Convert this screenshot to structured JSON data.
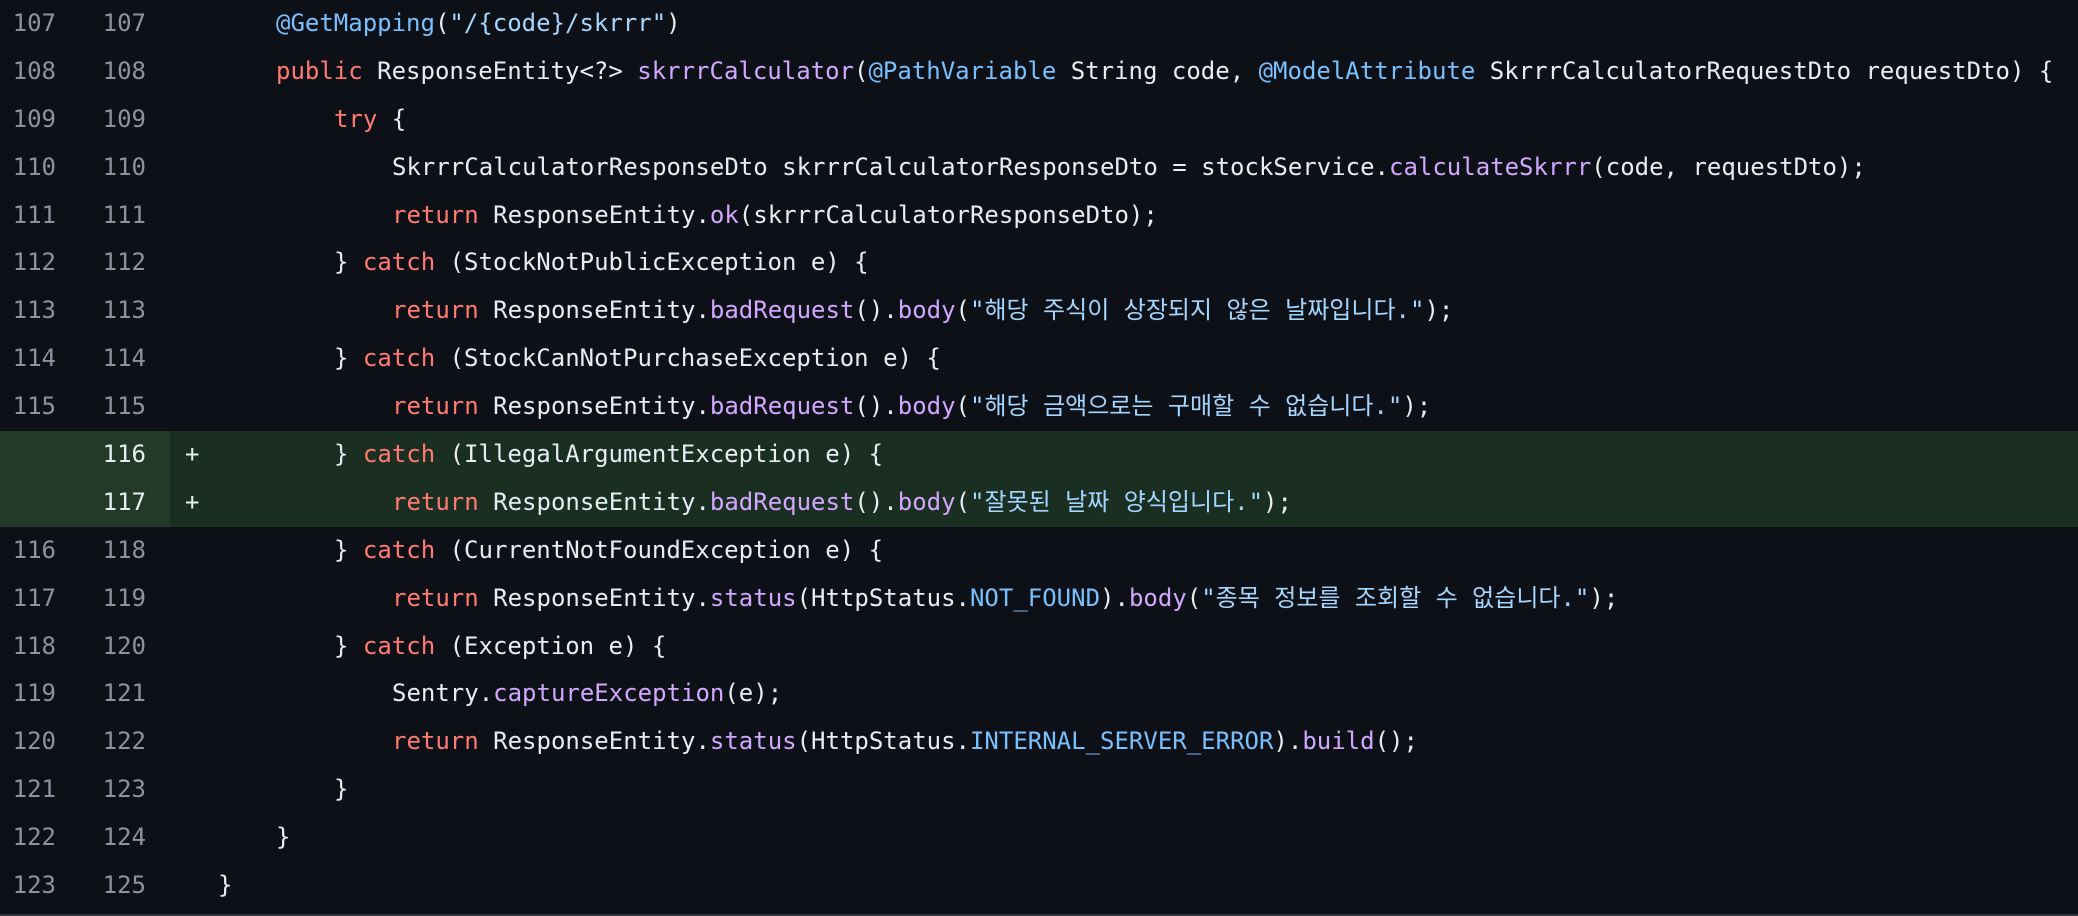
{
  "colors": {
    "background": "#0d1117",
    "added_background": "#1b2e22",
    "added_gutter": "#223a27",
    "line_number": "#8b949e",
    "keyword": "#ff7b72",
    "function": "#d2a8ff",
    "annotation": "#79c0ff",
    "string": "#a5d6ff",
    "text": "#e6edf3"
  },
  "lines": [
    {
      "old": "107",
      "new": "107",
      "marker": "",
      "type": "context",
      "indent": 1,
      "tokens": [
        {
          "t": "an",
          "v": "@GetMapping"
        },
        {
          "t": "tx",
          "v": "("
        },
        {
          "t": "st",
          "v": "\"/{code}/skrrr\""
        },
        {
          "t": "tx",
          "v": ")"
        }
      ]
    },
    {
      "old": "108",
      "new": "108",
      "marker": "",
      "type": "context",
      "indent": 1,
      "tokens": [
        {
          "t": "kw",
          "v": "public"
        },
        {
          "t": "tx",
          "v": " ResponseEntity<?> "
        },
        {
          "t": "fn",
          "v": "skrrrCalculator"
        },
        {
          "t": "tx",
          "v": "("
        },
        {
          "t": "an",
          "v": "@PathVariable"
        },
        {
          "t": "tx",
          "v": " String code, "
        },
        {
          "t": "an",
          "v": "@ModelAttribute"
        },
        {
          "t": "tx",
          "v": " SkrrrCalculatorRequestDto requestDto) {"
        }
      ]
    },
    {
      "old": "109",
      "new": "109",
      "marker": "",
      "type": "context",
      "indent": 2,
      "tokens": [
        {
          "t": "kw",
          "v": "try"
        },
        {
          "t": "tx",
          "v": " {"
        }
      ]
    },
    {
      "old": "110",
      "new": "110",
      "marker": "",
      "type": "context",
      "indent": 3,
      "tokens": [
        {
          "t": "tx",
          "v": "SkrrrCalculatorResponseDto skrrrCalculatorResponseDto = stockService."
        },
        {
          "t": "fn",
          "v": "calculateSkrrr"
        },
        {
          "t": "tx",
          "v": "(code, requestDto);"
        }
      ]
    },
    {
      "old": "111",
      "new": "111",
      "marker": "",
      "type": "context",
      "indent": 3,
      "tokens": [
        {
          "t": "kw",
          "v": "return"
        },
        {
          "t": "tx",
          "v": " ResponseEntity."
        },
        {
          "t": "fn",
          "v": "ok"
        },
        {
          "t": "tx",
          "v": "(skrrrCalculatorResponseDto);"
        }
      ]
    },
    {
      "old": "112",
      "new": "112",
      "marker": "",
      "type": "context",
      "indent": 2,
      "tokens": [
        {
          "t": "tx",
          "v": "} "
        },
        {
          "t": "kw",
          "v": "catch"
        },
        {
          "t": "tx",
          "v": " (StockNotPublicException e) {"
        }
      ]
    },
    {
      "old": "113",
      "new": "113",
      "marker": "",
      "type": "context",
      "indent": 3,
      "tokens": [
        {
          "t": "kw",
          "v": "return"
        },
        {
          "t": "tx",
          "v": " ResponseEntity."
        },
        {
          "t": "fn",
          "v": "badRequest"
        },
        {
          "t": "tx",
          "v": "()."
        },
        {
          "t": "fn",
          "v": "body"
        },
        {
          "t": "tx",
          "v": "("
        },
        {
          "t": "st",
          "v": "\"해당 주식이 상장되지 않은 날짜입니다.\""
        },
        {
          "t": "tx",
          "v": ");"
        }
      ]
    },
    {
      "old": "114",
      "new": "114",
      "marker": "",
      "type": "context",
      "indent": 2,
      "tokens": [
        {
          "t": "tx",
          "v": "} "
        },
        {
          "t": "kw",
          "v": "catch"
        },
        {
          "t": "tx",
          "v": " (StockCanNotPurchaseException e) {"
        }
      ]
    },
    {
      "old": "115",
      "new": "115",
      "marker": "",
      "type": "context",
      "indent": 3,
      "tokens": [
        {
          "t": "kw",
          "v": "return"
        },
        {
          "t": "tx",
          "v": " ResponseEntity."
        },
        {
          "t": "fn",
          "v": "badRequest"
        },
        {
          "t": "tx",
          "v": "()."
        },
        {
          "t": "fn",
          "v": "body"
        },
        {
          "t": "tx",
          "v": "("
        },
        {
          "t": "st",
          "v": "\"해당 금액으로는 구매할 수 없습니다.\""
        },
        {
          "t": "tx",
          "v": ");"
        }
      ]
    },
    {
      "old": "",
      "new": "116",
      "marker": "+",
      "type": "added",
      "indent": 2,
      "tokens": [
        {
          "t": "tx",
          "v": "} "
        },
        {
          "t": "kw",
          "v": "catch"
        },
        {
          "t": "tx",
          "v": " (IllegalArgumentException e) {"
        }
      ]
    },
    {
      "old": "",
      "new": "117",
      "marker": "+",
      "type": "added",
      "indent": 3,
      "tokens": [
        {
          "t": "kw",
          "v": "return"
        },
        {
          "t": "tx",
          "v": " ResponseEntity."
        },
        {
          "t": "fn",
          "v": "badRequest"
        },
        {
          "t": "tx",
          "v": "()."
        },
        {
          "t": "fn",
          "v": "body"
        },
        {
          "t": "tx",
          "v": "("
        },
        {
          "t": "st",
          "v": "\"잘못된 날짜 양식입니다.\""
        },
        {
          "t": "tx",
          "v": ");"
        }
      ]
    },
    {
      "old": "116",
      "new": "118",
      "marker": "",
      "type": "context",
      "indent": 2,
      "tokens": [
        {
          "t": "tx",
          "v": "} "
        },
        {
          "t": "kw",
          "v": "catch"
        },
        {
          "t": "tx",
          "v": " (CurrentNotFoundException e) {"
        }
      ]
    },
    {
      "old": "117",
      "new": "119",
      "marker": "",
      "type": "context",
      "indent": 3,
      "tokens": [
        {
          "t": "kw",
          "v": "return"
        },
        {
          "t": "tx",
          "v": " ResponseEntity."
        },
        {
          "t": "fn",
          "v": "status"
        },
        {
          "t": "tx",
          "v": "(HttpStatus."
        },
        {
          "t": "cn",
          "v": "NOT_FOUND"
        },
        {
          "t": "tx",
          "v": ")."
        },
        {
          "t": "fn",
          "v": "body"
        },
        {
          "t": "tx",
          "v": "("
        },
        {
          "t": "st",
          "v": "\"종목 정보를 조회할 수 없습니다.\""
        },
        {
          "t": "tx",
          "v": ");"
        }
      ]
    },
    {
      "old": "118",
      "new": "120",
      "marker": "",
      "type": "context",
      "indent": 2,
      "tokens": [
        {
          "t": "tx",
          "v": "} "
        },
        {
          "t": "kw",
          "v": "catch"
        },
        {
          "t": "tx",
          "v": " (Exception e) {"
        }
      ]
    },
    {
      "old": "119",
      "new": "121",
      "marker": "",
      "type": "context",
      "indent": 3,
      "tokens": [
        {
          "t": "tx",
          "v": "Sentry."
        },
        {
          "t": "fn",
          "v": "captureException"
        },
        {
          "t": "tx",
          "v": "(e);"
        }
      ]
    },
    {
      "old": "120",
      "new": "122",
      "marker": "",
      "type": "context",
      "indent": 3,
      "tokens": [
        {
          "t": "kw",
          "v": "return"
        },
        {
          "t": "tx",
          "v": " ResponseEntity."
        },
        {
          "t": "fn",
          "v": "status"
        },
        {
          "t": "tx",
          "v": "(HttpStatus."
        },
        {
          "t": "cn",
          "v": "INTERNAL_SERVER_ERROR"
        },
        {
          "t": "tx",
          "v": ")."
        },
        {
          "t": "fn",
          "v": "build"
        },
        {
          "t": "tx",
          "v": "();"
        }
      ]
    },
    {
      "old": "121",
      "new": "123",
      "marker": "",
      "type": "context",
      "indent": 2,
      "tokens": [
        {
          "t": "tx",
          "v": "}"
        }
      ]
    },
    {
      "old": "122",
      "new": "124",
      "marker": "",
      "type": "context",
      "indent": 1,
      "tokens": [
        {
          "t": "tx",
          "v": "}"
        }
      ]
    },
    {
      "old": "123",
      "new": "125",
      "marker": "",
      "type": "context",
      "indent": 0,
      "tokens": [
        {
          "t": "tx",
          "v": "}"
        }
      ]
    }
  ]
}
